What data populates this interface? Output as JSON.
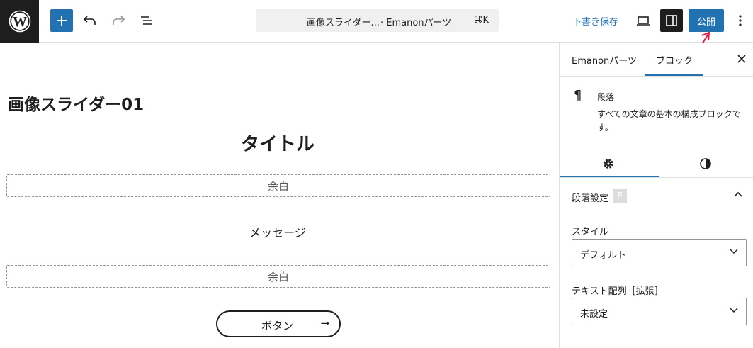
{
  "topbar": {
    "logo_icon": "wordpress-logo-icon",
    "add_icon": "plus-icon",
    "undo_icon": "undo-icon",
    "redo_icon": "redo-icon",
    "outline_icon": "document-overview-icon",
    "command": {
      "title": "画像スライダー...",
      "subtitle": "· Emanonパーツ",
      "shortcut": "⌘K"
    },
    "save_draft_label": "下書き保存",
    "preview_icon": "laptop-preview-icon",
    "settings_icon": "sidebar-toggle-icon",
    "publish_label": "公開",
    "options_icon": "more-vertical-icon"
  },
  "canvas": {
    "post_title": "画像スライダー01",
    "block_title": "タイトル",
    "spacer1_label": "余白",
    "message": "メッセージ",
    "spacer2_label": "余白",
    "button_label": "ボタン",
    "button_arrow": "→"
  },
  "sidebar": {
    "tabs": [
      {
        "label": "Emanonパーツ"
      },
      {
        "label": "ブロック"
      }
    ],
    "close_icon": "close-icon",
    "block": {
      "icon": "¶",
      "name": "段落",
      "description": "すべての文章の基本の構成ブロックです。"
    },
    "subtabs_icons": [
      "gear-icon",
      "contrast-icon"
    ],
    "panel": {
      "heading": "段落設定",
      "badge": "E",
      "style_label": "スタイル",
      "style_value": "デフォルト",
      "align_label": "テキスト配列［拡張］",
      "align_value": "未設定"
    }
  },
  "colors": {
    "accent": "#2271b1",
    "dark": "#1e1e1e",
    "annotation_arrow": "#e0254a"
  }
}
